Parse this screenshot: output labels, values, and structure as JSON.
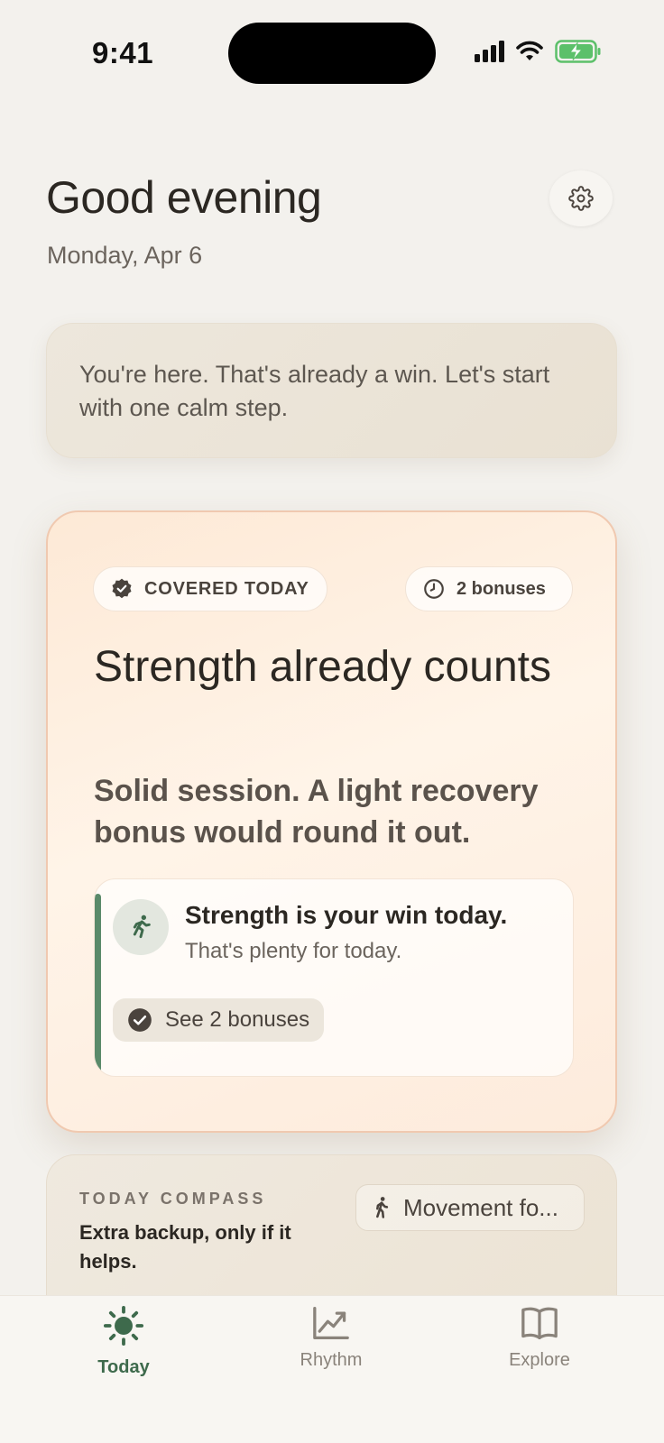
{
  "status_bar": {
    "time": "9:41"
  },
  "header": {
    "greeting": "Good evening",
    "date": "Monday, Apr 6"
  },
  "note": {
    "text": "You're here. That's already a win. Let's start with one calm step."
  },
  "hero": {
    "covered_label": "COVERED TODAY",
    "bonus_label": "2 bonuses",
    "title": "Strength already counts",
    "subtitle": "Solid session. A light recovery bonus would round it out.",
    "win": {
      "title": "Strength is your win today.",
      "subtitle": "That's plenty for today.",
      "button": "See 2 bonuses"
    }
  },
  "compass": {
    "label": "TODAY COMPASS",
    "text": "Extra backup, only if it helps.",
    "chip": "Movement fo..."
  },
  "tabs": [
    {
      "label": "Today",
      "icon": "sun-icon",
      "active": true
    },
    {
      "label": "Rhythm",
      "icon": "chart-icon",
      "active": false
    },
    {
      "label": "Explore",
      "icon": "book-icon",
      "active": false
    }
  ],
  "colors": {
    "accent_green": "#3e6a4c",
    "hero_border": "#f0c9b0",
    "background": "#f3f1ed"
  }
}
